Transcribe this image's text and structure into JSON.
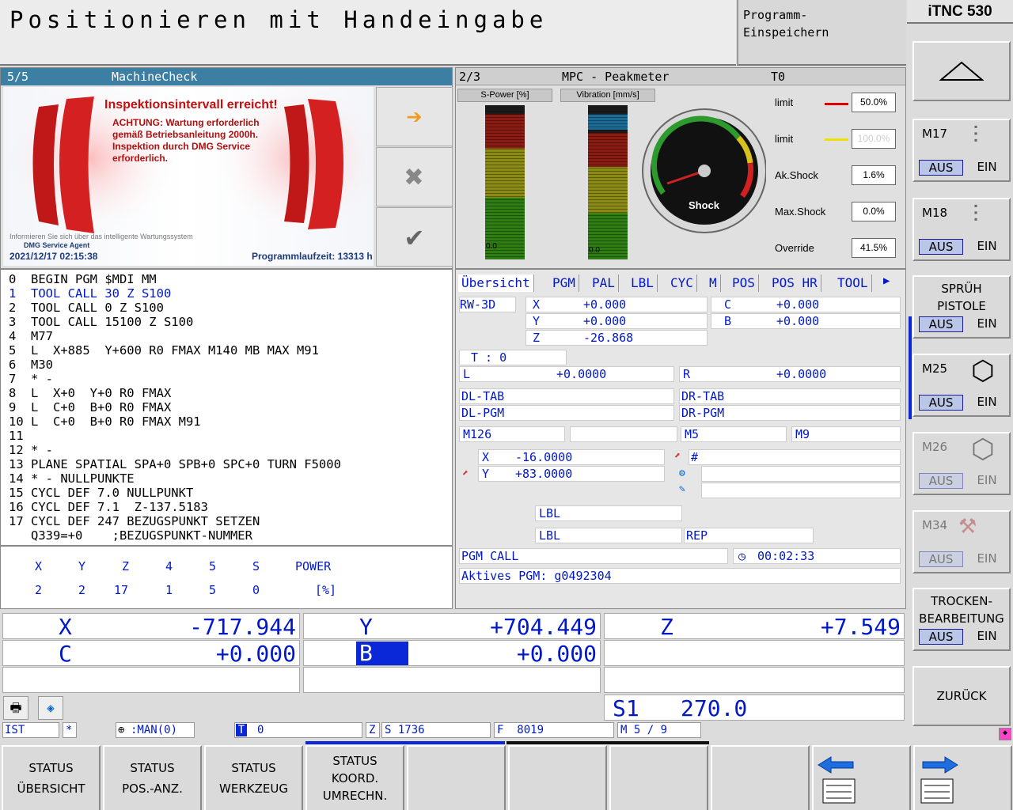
{
  "header": {
    "mode_title": "Positionieren mit Handeingabe",
    "side_line1": "Programm-",
    "side_line2": "Einspeichern",
    "brand": "iTNC 530"
  },
  "machinecheck": {
    "page": "5/5",
    "title": "MachineCheck",
    "headline": "Inspektionsintervall erreicht!",
    "msg1": "ACHTUNG: Wartung erforderlich",
    "msg2": "gemäß Betriebsanleitung 2000h.",
    "msg3": "Inspektion durch DMG Service",
    "msg4": "erforderlich.",
    "info": "Informieren Sie sich über das intelligente Wartungssystem",
    "agent": "DMG Service Agent",
    "timestamp": "2021/12/17 02:15:38",
    "runtime": "Programmlaufzeit: 13313 h"
  },
  "peak": {
    "page": "2/3",
    "title": "MPC - Peakmeter",
    "tool": "T0",
    "spower_label": "S-Power [%]",
    "vib_label": "Vibration [mm/s]",
    "spower_val": "0.0",
    "vib_val": "0.0",
    "gauge_label": "Shock",
    "limit1_label": "limit",
    "limit1": "50.0%",
    "limit2_label": "limit",
    "limit2": "100.0%",
    "akshock_label": "Ak.Shock",
    "akshock": "1.6%",
    "maxshock_label": "Max.Shock",
    "maxshock": "0.0%",
    "override_label": "Override",
    "override": "41.5%",
    "colors": {
      "limit1": "#e00000",
      "limit2": "#f0e000"
    }
  },
  "program": {
    "lines": [
      "0  BEGIN PGM $MDI MM",
      "1  TOOL CALL 30 Z S100",
      "2  TOOL CALL 0 Z S100",
      "3  TOOL CALL 15100 Z S100",
      "4  M77",
      "5  L  X+885  Y+600 R0 FMAX M140 MB MAX M91",
      "6  M30",
      "7  * -",
      "8  L  X+0  Y+0 R0 FMAX",
      "9  L  C+0  B+0 R0 FMAX",
      "10 L  C+0  B+0 R0 FMAX M91",
      "11",
      "12 * -",
      "13 PLANE SPATIAL SPA+0 SPB+0 SPC+0 TURN F5000",
      "14 * - NULLPUNKTE",
      "15 CYCL DEF 7.0 NULLPUNKT",
      "16 CYCL DEF 7.1  Z-137.5183",
      "17 CYCL DEF 247 BEZUGSPUNKT SETZEN",
      "   Q339=+0    ;BEZUGSPUNKT-NUMMER"
    ]
  },
  "axis_table": {
    "headers": [
      "X",
      "Y",
      "Z",
      "4",
      "5",
      "S",
      "POWER"
    ],
    "values": [
      "2",
      "2",
      "17",
      "1",
      "5",
      "0",
      "[%]"
    ]
  },
  "status": {
    "tabs": [
      "Übersicht",
      "PGM",
      "PAL",
      "LBL",
      "CYC",
      "M",
      "POS",
      "POS HR",
      "TOOL"
    ],
    "rw3d": "RW-3D",
    "x_label": "X",
    "x_val": "+0.000",
    "y_label": "Y",
    "y_val": "+0.000",
    "z_label": "Z",
    "z_val": "-26.868",
    "c_label": "C",
    "c_val": "+0.000",
    "b_label": "B",
    "b_val": "+0.000",
    "t_label": "T : 0",
    "l_label": "L",
    "l_val": "+0.0000",
    "r_label": "R",
    "r_val": "+0.0000",
    "dltab": "DL-TAB",
    "drtab": "DR-TAB",
    "dlpgm": "DL-PGM",
    "drpgm": "DR-PGM",
    "m126": "M126",
    "m5": "M5",
    "m9": "M9",
    "sx_label": "X",
    "sx_val": "-16.0000",
    "sy_label": "Y",
    "sy_val": "+83.0000",
    "hash": "#",
    "lbl1": "LBL",
    "lbl2": "LBL",
    "rep": "REP",
    "pgmcall": "PGM CALL",
    "time": "00:02:33",
    "active_pgm": "Aktives PGM: g0492304"
  },
  "positions": {
    "x_label": "X",
    "x_val": "-717.944",
    "y_label": "Y",
    "y_val": "+704.449",
    "z_label": "Z",
    "z_val": "+7.549",
    "c_label": "C",
    "c_val": "+0.000",
    "b_label": "B",
    "b_val": "+0.000",
    "s_label": "S1",
    "s_val": "270.0"
  },
  "statusbar": {
    "ist": "IST",
    "star": "*",
    "man": ":MAN(0)",
    "t": "T",
    "t_val": "0",
    "z": "Z",
    "s_val": "S 1736",
    "f_val": "F  8019",
    "m_val": "M 5 / 9"
  },
  "softkeys": [
    [
      "STATUS",
      "ÜBERSICHT"
    ],
    [
      "STATUS",
      "POS.-ANZ."
    ],
    [
      "STATUS",
      "WERKZEUG"
    ],
    [
      "STATUS",
      "KOORD.",
      "UMRECHN."
    ]
  ],
  "vkeys": {
    "m17": "M17",
    "m18": "M18",
    "spray1": "SPRÜH",
    "spray2": "PISTOLE",
    "m25": "M25",
    "m26": "M26",
    "m34": "M34",
    "dry1": "TROCKEN-",
    "dry2": "BEARBEITUNG",
    "back": "ZURÜCK",
    "aus": "AUS",
    "ein": "EIN"
  }
}
